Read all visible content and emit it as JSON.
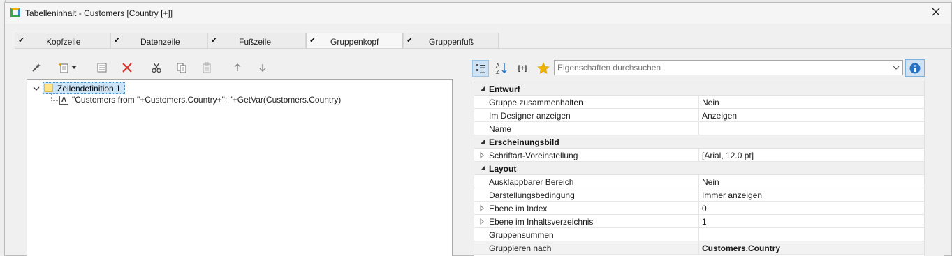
{
  "window": {
    "title": "Tabelleninhalt - Customers [Country [+]]"
  },
  "tabs": [
    {
      "label": "Kopfzeile",
      "checked": true,
      "active": false
    },
    {
      "label": "Datenzeile",
      "checked": true,
      "active": false
    },
    {
      "label": "Fußzeile",
      "checked": true,
      "active": false
    },
    {
      "label": "Gruppenkopf",
      "checked": true,
      "active": true
    },
    {
      "label": "Gruppenfuß",
      "checked": true,
      "active": false
    }
  ],
  "left_toolbar": {
    "icons": [
      "wand-icon",
      "new-item-icon",
      "dropdown-arrow-icon",
      "properties-icon",
      "delete-icon",
      "cut-icon",
      "copy-icon",
      "paste-icon",
      "move-up-icon",
      "move-down-icon"
    ]
  },
  "tree": {
    "root_label": "Zeilendefinition  1",
    "child_icon_letter": "A",
    "child_label": "\"Customers from \"+Customers.Country+\": \"+GetVar(Customers.Country)"
  },
  "right_toolbar": {
    "icons": [
      "categorized-icon",
      "sort-az-icon",
      "expand-all-icon",
      "favorites-star-icon",
      "info-icon"
    ],
    "expand_label": "[+]"
  },
  "search": {
    "placeholder": "Eigenschaften durchsuchen",
    "value": ""
  },
  "properties": {
    "cat_entwurf": "Entwurf",
    "p1_name": "Gruppe zusammenhalten",
    "p1_value": "Nein",
    "p2_name": "Im Designer anzeigen",
    "p2_value": "Anzeigen",
    "p3_name": "Name",
    "p3_value": "",
    "cat_erscheinung": "Erscheinungsbild",
    "p4_name": "Schriftart-Voreinstellung",
    "p4_value": "[Arial, 12.0 pt]",
    "cat_layout": "Layout",
    "p5_name": "Ausklappbarer Bereich",
    "p5_value": "Nein",
    "p6_name": "Darstellungsbedingung",
    "p6_value": "Immer anzeigen",
    "p7_name": "Ebene im Index",
    "p7_value": "0",
    "p8_name": "Ebene im Inhaltsverzeichnis",
    "p8_value": "1",
    "p9_name": "Gruppensummen",
    "p9_value": "",
    "p10_name": "Gruppieren nach",
    "p10_value": "Customers.Country"
  },
  "colors": {
    "selection": "#cce4f7",
    "delete_red": "#d9342b",
    "star": "#f0b400",
    "info_blue": "#2a73c2"
  }
}
